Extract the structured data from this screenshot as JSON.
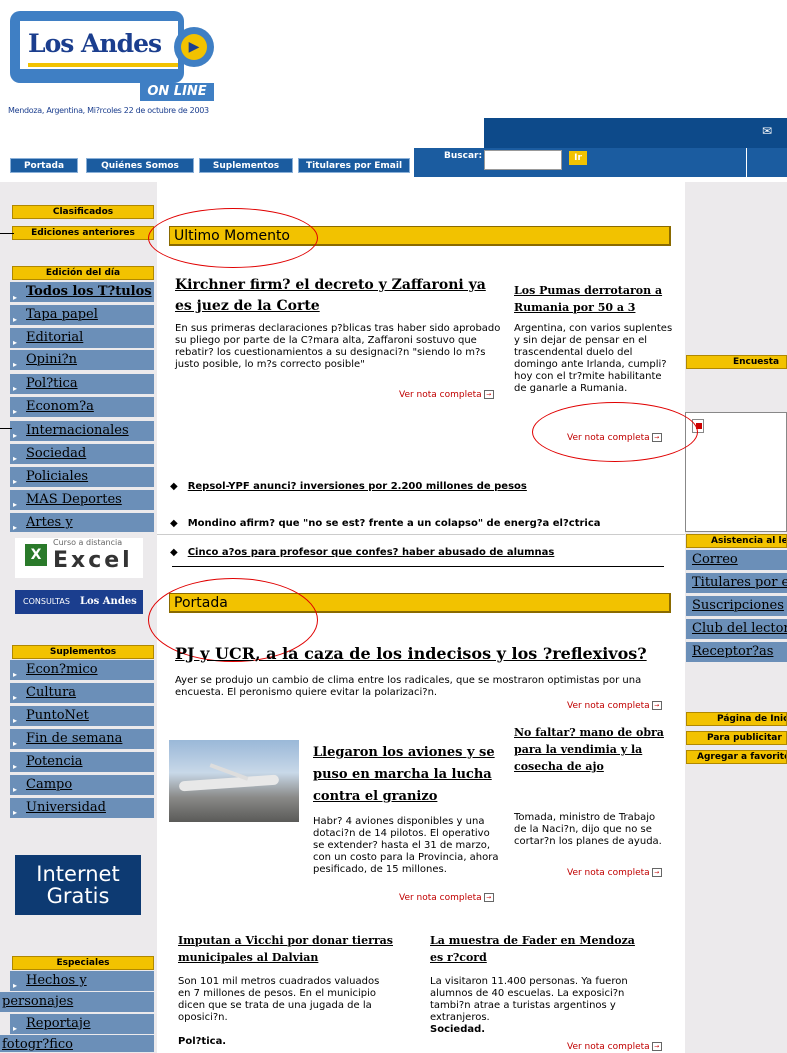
{
  "header": {
    "logo_name": "Los Andes",
    "logo_sub": "ON LINE",
    "dateline": "Mendoza, Argentina, Mi?rcoles 22 de octubre de 2003"
  },
  "nav": {
    "items": [
      "Portada",
      "Quiénes Somos",
      "Suplementos",
      "Titulares por Email"
    ],
    "search_label": "Buscar:",
    "search_button": "Ir"
  },
  "left": {
    "clasificados": "Clasificados",
    "ediciones": "Ediciones anteriores",
    "edicion_head": "Edición del día",
    "edicion_items": [
      "Todos los T?tulos",
      "Tapa papel",
      "Editorial",
      "Opini?n",
      "Pol?tica",
      "Econom?a",
      "Internacionales",
      "Sociedad",
      "Policiales",
      "MAS Deportes",
      "Artes y"
    ],
    "excel_top": "Curso a distancia",
    "excel_text": "Excel",
    "consultas": "CONSULTAS",
    "consultas_brand": "Los Andes",
    "suplementos_head": "Suplementos",
    "suplementos_items": [
      "Econ?mico",
      "Cultura",
      "PuntoNet",
      "Fin de semana",
      "Potencia",
      "Campo",
      "Universidad"
    ],
    "internet": [
      "Internet",
      "Gratis"
    ],
    "especiales_head": "Especiales",
    "especiales_items": [
      "Hechos y",
      "personajes",
      "Reportaje",
      "fotogr?fico"
    ]
  },
  "right": {
    "encuesta": "Encuesta",
    "asistencia": "Asistencia al lector",
    "asistencia_items": [
      "Correo",
      "Titulares por e-mail",
      "Suscripciones",
      "Club del lector",
      "Receptor?as"
    ],
    "pagina": "Página de Inicio",
    "publicitar": "Para publicitar",
    "favoritos": "Agregar a favoritos"
  },
  "ultimo": {
    "header": "Ultimo Momento",
    "main_headline": "Kirchner firm? el decreto y Zaffaroni ya es juez de la Corte",
    "main_body": "En sus primeras declaraciones p?blicas tras haber sido aprobado su pliego por parte de la C?mara alta, Zaffaroni sostuvo que rebatir? los cuestionamientos a su designaci?n \"siendo lo m?s justo posible, lo m?s correcto posible\"",
    "side_headline": "Los Pumas derrotaron a Rumania por 50 a 3",
    "side_body": "Argentina, con varios suplentes y sin dejar de pensar en el trascendental duelo del domingo ante Irlanda, cumpli? hoy con el tr?mite habilitante de ganarle a Rumania.",
    "more": "Ver nota completa",
    "bullets": [
      "Repsol-YPF anunci? inversiones por 2.200 millones de pesos",
      "Mondino afirm? que \"no se est? frente a un colapso\" de energ?a el?ctrica",
      "Cinco a?os para profesor que confes? haber abusado de alumnas"
    ]
  },
  "portada": {
    "header": "Portada",
    "main_headline": "PJ y UCR, a la caza de los indecisos y los ?reflexivos?",
    "main_body": "Ayer se produjo un cambio de clima entre los radicales, que se mostraron optimistas por una encuesta. El peronismo quiere evitar la polarizaci?n.",
    "story2_headline": "Llegaron los aviones y se puso en marcha la lucha contra el granizo",
    "story2_body": "Habr? 4 aviones disponibles y una dotaci?n de 14 pilotos. El operativo se extender? hasta el 31 de marzo, con un costo para la Provincia, ahora pesificado, de 15 millones.",
    "story3_headline": "No faltar? mano de obra para la vendimia y la cosecha de ajo",
    "story3_body": "Tomada, ministro de Trabajo de la Naci?n, dijo que no se cortar?n los planes de ayuda.",
    "story4_headline": "Imputan a Vicchi por donar tierras municipales al Dalvian",
    "story4_body": "Son 101 mil metros cuadrados valuados en 7 millones de pesos. En el municipio dicen que se trata de una jugada de la oposici?n.",
    "story4_section": "Pol?tica.",
    "story5_headline": "La muestra de Fader en Mendoza es r?cord",
    "story5_body": "La visitaron 11.400 personas. Ya fueron alumnos de 40 escuelas. La exposici?n tambi?n atrae a turistas argentinos y extranjeros.",
    "story5_section": "Sociedad.",
    "more": "Ver nota completa"
  },
  "colors": {
    "accent": "#f2c200",
    "nav_blue": "#1b5ca0",
    "item_blue": "#6b8fb8",
    "annotation": "#e00000"
  }
}
